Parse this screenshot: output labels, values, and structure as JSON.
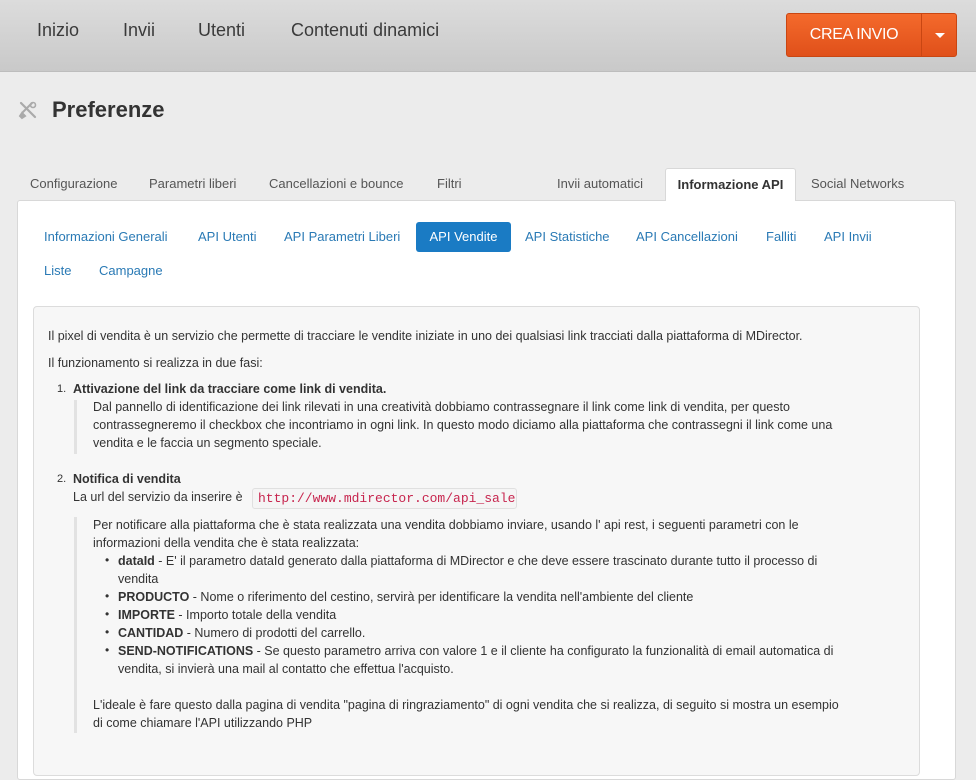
{
  "nav": {
    "items": [
      "Inizio",
      "Invii",
      "Utenti",
      "Contenuti dinamici"
    ],
    "create_label": "CREA INVIO"
  },
  "page": {
    "title": "Preferenze"
  },
  "tabs": {
    "items": [
      "Configurazione",
      "Parametri liberi",
      "Cancellazioni e bounce",
      "Filtri",
      "Invii automatici",
      "Informazione API",
      "Social Networks"
    ],
    "active": "Informazione API"
  },
  "subtabs": {
    "items": [
      "Informazioni Generali",
      "API Utenti",
      "API Parametri Liberi",
      "API Vendite",
      "API Statistiche",
      "API Cancellazioni",
      "Falliti",
      "API Invii",
      "Liste",
      "Campagne"
    ],
    "active": "API Vendite"
  },
  "content": {
    "intro1": "Il pixel di vendita è un servizio che permette di tracciare le vendite iniziate in uno dei qualsiasi link tracciati dalla piattaforma di MDirector.",
    "intro2": "Il funzionamento si realizza in due fasi:",
    "step1": {
      "num": "1.",
      "title": "Attivazione del link da tracciare come link di vendita.",
      "lines": [
        "Dal pannello di identificazione dei link rilevati in una creatività dobbiamo contrassegnare il link come link di vendita, per questo",
        "contrassegneremo il checkbox che incontriamo in ogni link. In questo modo diciamo alla piattaforma che contrassegni il link come una",
        "vendita e le faccia un segmento speciale."
      ]
    },
    "step2": {
      "num": "2.",
      "title": "Notifica di vendita",
      "url_label": "La url del servizio da inserire è",
      "url": "http://www.mdirector.com/api_sale",
      "lines": [
        "Per notificare alla piattaforma che è stata realizzata una vendita dobbiamo inviare, usando l' api rest, i seguenti parametri con le",
        "informazioni della vendita che è stata realizzata:"
      ],
      "params": [
        {
          "name": "dataId",
          "desc": " - E' il parametro dataId generato dalla piattaforma di MDirector e che deve essere trascinato durante tutto il processo di",
          "desc2": "vendita"
        },
        {
          "name": "PRODUCTO",
          "desc": " - Nome o riferimento del cestino, servirà per identificare la vendita nell'ambiente del cliente"
        },
        {
          "name": "IMPORTE",
          "desc": " - Importo totale della vendita"
        },
        {
          "name": "CANTIDAD",
          "desc": " - Numero di prodotti del carrello."
        },
        {
          "name": "SEND-NOTIFICATIONS",
          "desc": " - Se questo parametro arriva con valore 1 e il cliente ha configurato la funzionalità di email automatica di",
          "desc2": "vendita, si invierà una mail al contatto che effettua l'acquisto."
        }
      ],
      "closing": [
        "L'ideale è fare questo dalla pagina di vendita \"pagina di ringraziamento\" di ogni vendita che si realizza, di seguito si mostra un esempio",
        "di come chiamare l'API utilizzando PHP"
      ]
    }
  },
  "colors": {
    "accent": "#1a7bc4",
    "cta": "#f05f24",
    "code": "#c7254e"
  }
}
